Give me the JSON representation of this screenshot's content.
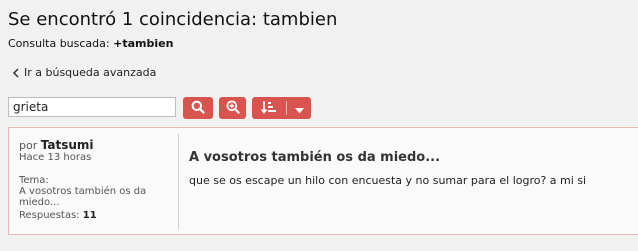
{
  "header": {
    "title": "Se encontró 1 coincidencia: tambien",
    "query_label": "Consulta buscada:",
    "query_value": "+tambien"
  },
  "nav": {
    "back_label": "Ir a búsqueda avanzada"
  },
  "search": {
    "value": "grieta"
  },
  "icons": {
    "search": "search-icon",
    "zoom": "zoom-in-icon",
    "sort": "sort-icon",
    "caret": "caret-down-icon",
    "back": "chevron-left-icon"
  },
  "colors": {
    "accent": "#d9534f",
    "result_border": "#e4b9b6"
  },
  "results": [
    {
      "by_label": "por",
      "author": "Tatsumi",
      "time": "Hace 13 horas",
      "topic_label": "Tema:",
      "topic": "A vosotros también os da miedo...",
      "replies_label": "Respuestas:",
      "replies": "11",
      "post_title": "A vosotros también os da miedo...",
      "post_body": "que se os escape un hilo con encuesta y no sumar para el logro? a mi si"
    }
  ]
}
